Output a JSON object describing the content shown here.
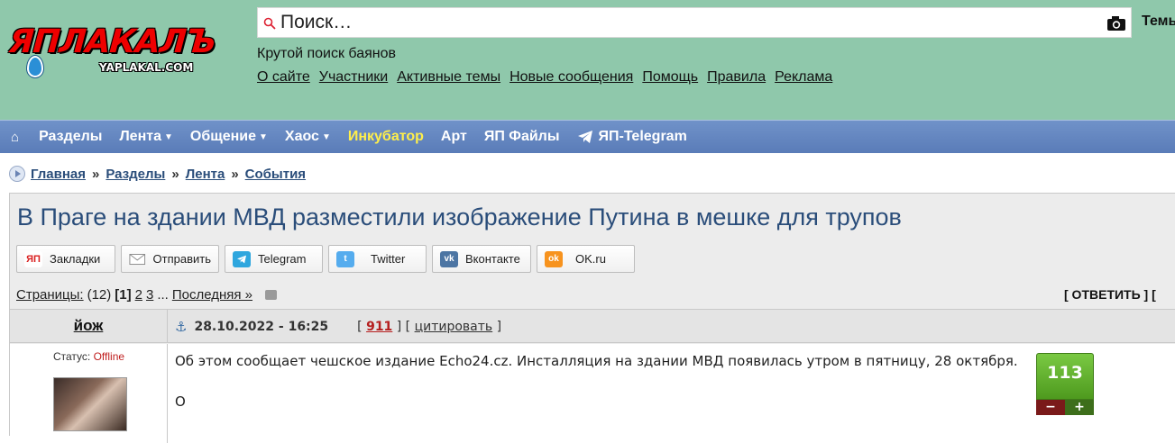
{
  "header": {
    "logo_text": "ЯПЛАКАЛЪ",
    "logo_subtext": "YAPLAKAL.COM",
    "search_placeholder": "Поиск…",
    "themes_label": "Темы",
    "search_tagline": "Крутой поиск баянов",
    "links": [
      "О сайте",
      "Участники",
      "Активные темы",
      "Новые сообщения",
      "Помощь",
      "Правила",
      "Реклама"
    ]
  },
  "nav": {
    "home_icon": "home-icon",
    "items": [
      {
        "label": "Разделы",
        "dropdown": false
      },
      {
        "label": "Лента",
        "dropdown": true
      },
      {
        "label": "Общение",
        "dropdown": true
      },
      {
        "label": "Хаос",
        "dropdown": true
      },
      {
        "label": "Инкубатор",
        "dropdown": false,
        "highlight": true
      },
      {
        "label": "Арт",
        "dropdown": false
      },
      {
        "label": "ЯП Файлы",
        "dropdown": false
      },
      {
        "label": "ЯП-Telegram",
        "dropdown": false,
        "icon": "telegram-icon"
      }
    ],
    "highlight_color": "#ffef4a"
  },
  "breadcrumb": {
    "items": [
      "Главная",
      "Разделы",
      "Лента",
      "События"
    ],
    "separator": "»"
  },
  "topic": {
    "title": "В Праге на здании МВД разместили изображение Путина в мешке для трупов"
  },
  "share": {
    "buttons": [
      {
        "label": "Закладки",
        "icon": "yaplakal-icon",
        "color": "#d92020"
      },
      {
        "label": "Отправить",
        "icon": "envelope-icon",
        "color": "#9a9a9a"
      },
      {
        "label": "Telegram",
        "icon": "telegram-icon",
        "color": "#2ea6de"
      },
      {
        "label": "Twitter",
        "icon": "twitter-icon",
        "color": "#55acee"
      },
      {
        "label": "Вконтакте",
        "icon": "vk-icon",
        "color": "#4c75a3"
      },
      {
        "label": "OK.ru",
        "icon": "odnoklassniki-icon",
        "color": "#f7931e"
      }
    ]
  },
  "pagination": {
    "label": "Страницы:",
    "total": "(12)",
    "current": "[1]",
    "pages": [
      "2",
      "3"
    ],
    "ellipsis": "...",
    "last_label": "Последняя »",
    "reply_label": "[ ОТВЕТИТЬ ] ["
  },
  "post": {
    "author": "йож",
    "date": "28.10.2022 - 16:25",
    "number": "911",
    "cite_label": "цитировать",
    "status_label": "Статус:",
    "status_value": "Offline",
    "status_color": "#c02020",
    "text": [
      "Об этом сообщает чешское издание Echo24.cz. Инсталляция на здании МВД появилась утром в пятницу, 28 октября.",
      "О"
    ],
    "rating": "113",
    "rating_minus": "−",
    "rating_plus": "+",
    "rating_color": "#5fae2a"
  }
}
